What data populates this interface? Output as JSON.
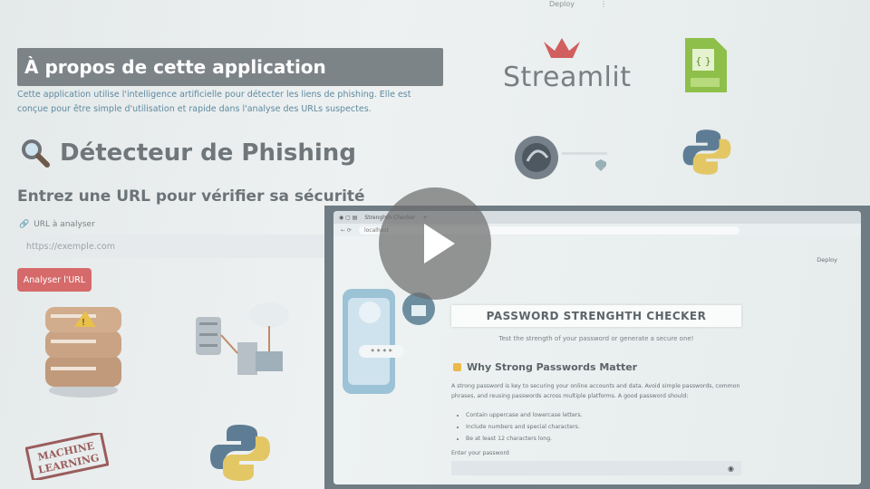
{
  "topbar": {
    "deploy": "Deploy",
    "menu": "⋮"
  },
  "about": {
    "title": "À propos de cette application",
    "text": "Cette application utilise l'intelligence artificielle pour détecter les liens de phishing. Elle est conçue pour être simple d'utilisation et rapide dans l'analyse des URLs suspectes."
  },
  "detector": {
    "icon": "magnifier-icon",
    "title": "Détecteur de Phishing",
    "subtitle": "Entrez une URL pour vérifier sa sécurité",
    "url_label": "URL à analyser",
    "url_placeholder": "https://exemple.com",
    "analyze_button": "Analyser l'URL"
  },
  "logos": {
    "streamlit": "Streamlit",
    "machine_learning": "MACHINE LEARNING"
  },
  "video": {
    "tab_title": "Strenghth Checker",
    "address": "localhost",
    "deploy": "Deploy",
    "app_title": "PASSWORD STRENGHTH CHECKER",
    "app_subtitle": "Test the strength of your password or generate a secure one!",
    "section_title": "Why Strong Passwords Matter",
    "section_text": "A strong password is key to securing your online accounts and data. Avoid simple passwords, common phrases, and reusing passwords across multiple platforms. A good password should:",
    "list": [
      "Contain uppercase and lowercase letters.",
      "Include numbers and special characters.",
      "Be at least 12 characters long."
    ],
    "password_label": "Enter your password",
    "play_icon": "play-icon"
  }
}
